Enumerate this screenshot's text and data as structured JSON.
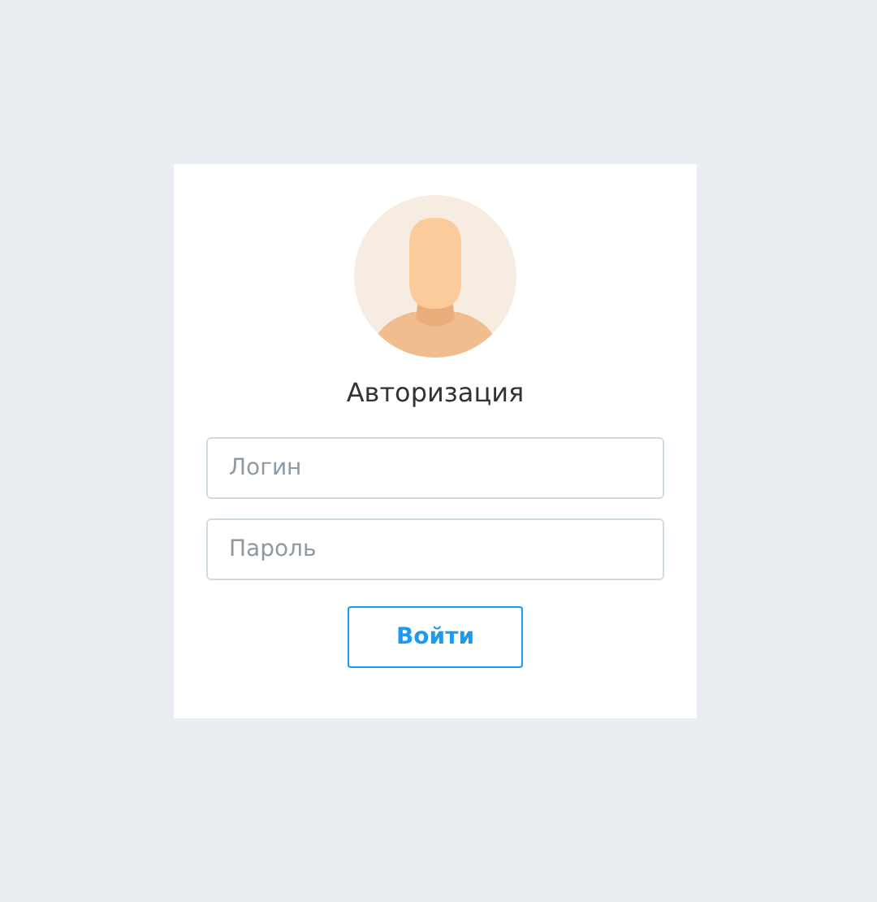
{
  "login_form": {
    "title": "Авторизация",
    "login_field": {
      "placeholder": "Логин"
    },
    "password_field": {
      "placeholder": "Пароль"
    },
    "submit_button": {
      "label": "Войти"
    }
  }
}
